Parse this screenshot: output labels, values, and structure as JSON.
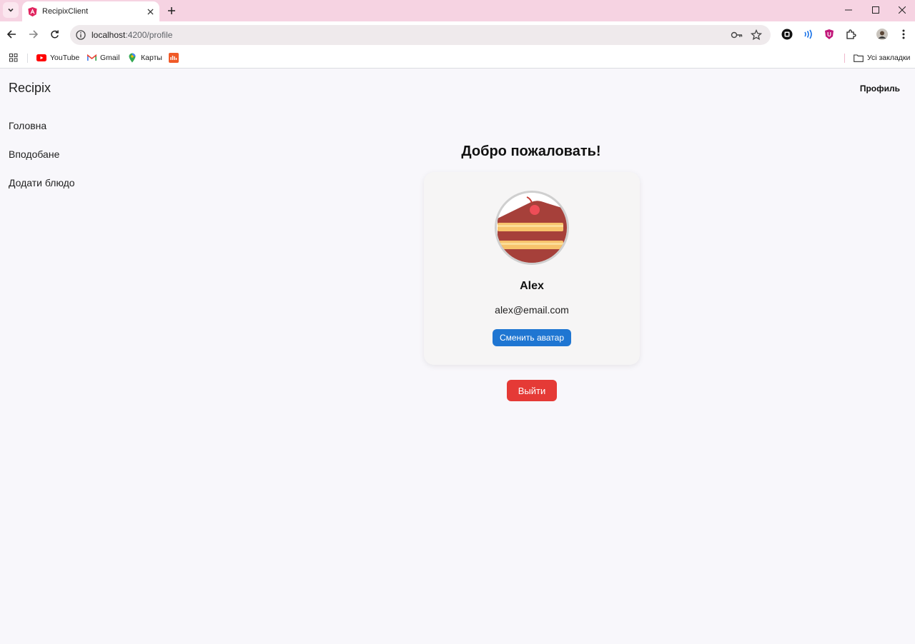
{
  "browser": {
    "tab_title": "RecipixClient",
    "url_host": "localhost",
    "url_path": ":4200/profile",
    "icons": [
      "tab-search-icon",
      "angular-favicon-icon",
      "close-tab-icon",
      "new-tab-icon",
      "minimize-icon",
      "maximize-icon",
      "close-window-icon",
      "back-icon",
      "forward-icon",
      "reload-icon",
      "site-info-icon",
      "password-key-icon",
      "bookmark-star-icon",
      "extensions-icon",
      "avatar-icon",
      "menu-icon"
    ]
  },
  "bookmarks": {
    "items": [
      {
        "label": "YouTube",
        "icon": "youtube-icon"
      },
      {
        "label": "Gmail",
        "icon": "gmail-icon"
      },
      {
        "label": "Карты",
        "icon": "maps-icon"
      }
    ],
    "all_bookmarks": "Усі закладки"
  },
  "app": {
    "brand": "Recipix",
    "header_link": "Профиль",
    "sidebar": [
      {
        "label": "Головна"
      },
      {
        "label": "Вподобане"
      },
      {
        "label": "Додати блюдо"
      }
    ]
  },
  "profile": {
    "heading": "Добро пожаловать!",
    "name": "Alex",
    "email": "alex@email.com",
    "change_avatar": "Сменить аватар",
    "logout": "Выйти",
    "avatar_icon": "cake-slice-icon"
  },
  "colors": {
    "tabstrip": "#f6d3e2",
    "primary_button": "#1f76d2",
    "danger_button": "#e53a36",
    "page_bg": "#f8f7fb"
  }
}
